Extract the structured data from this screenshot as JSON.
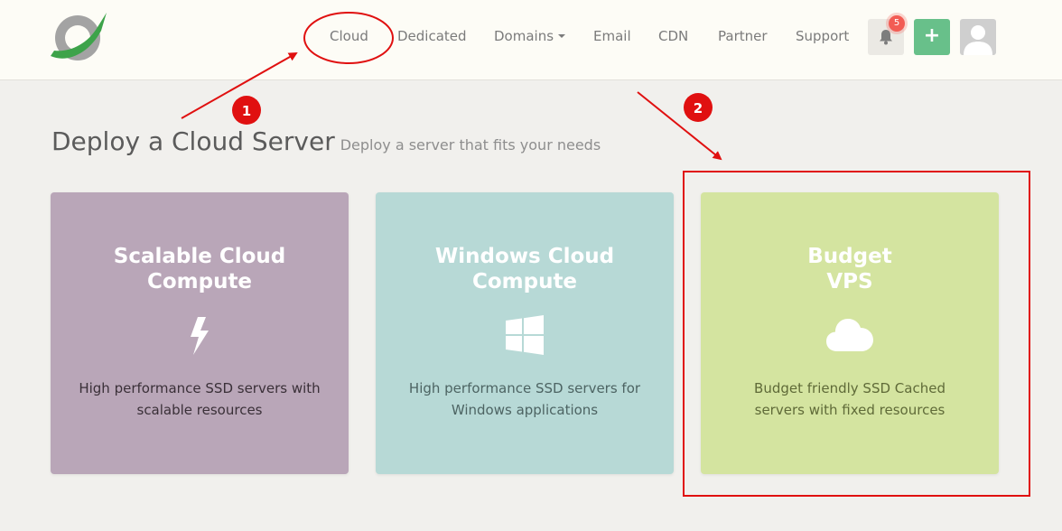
{
  "nav": {
    "links": [
      "Cloud",
      "Dedicated",
      "Domains",
      "Email",
      "CDN",
      "Partner",
      "Support"
    ],
    "notification_count": "5",
    "add_label": "+"
  },
  "header": {
    "title": "Deploy a Cloud Server",
    "subtitle": "Deploy a server that fits your needs"
  },
  "cards": [
    {
      "title": "Scalable Cloud\nCompute",
      "icon": "lightning-bolt-icon",
      "description": "High performance SSD servers with\nscalable resources",
      "color": "#b9a6b8"
    },
    {
      "title": "Windows Cloud\nCompute",
      "icon": "windows-logo-icon",
      "description": "High performance SSD servers for\nWindows applications",
      "color": "#b7d9d6"
    },
    {
      "title": "Budget\nVPS",
      "icon": "cloud-icon",
      "description": "Budget friendly SSD Cached\nservers with fixed resources",
      "color": "#d4e4a0"
    }
  ],
  "annotations": {
    "step1": "1",
    "step2": "2",
    "color": "#e01010"
  },
  "colors": {
    "background": "#f1f0ed",
    "navbar": "#fdfcf6",
    "add_button": "#68c08a",
    "badge": "#f25c54"
  }
}
